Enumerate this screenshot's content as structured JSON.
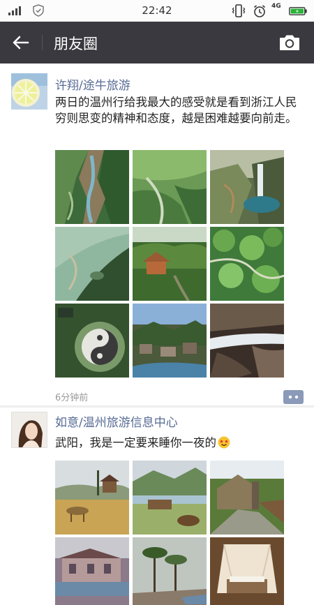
{
  "status_bar": {
    "time": "22:42",
    "network": "4G",
    "icons": [
      "signal-icon",
      "shield-icon",
      "vibrate-icon",
      "alarm-icon",
      "battery-icon"
    ],
    "battery_color": "#2ab43a"
  },
  "header": {
    "title": "朋友圈",
    "back_icon": "back-arrow-icon",
    "camera_icon": "camera-icon",
    "background_color": "#39393f"
  },
  "feed": {
    "link_color": "#576b95",
    "posts": [
      {
        "username": "许翔/途牛旅游",
        "text": "两日的温州行给我最大的感受就是看到浙江人民穷则思变的精神和态度，越是困难越要向前走。",
        "time": "6分钟前",
        "photos": [
          "aerial gorge with river",
          "green forested valley",
          "waterfall with pool",
          "aerial lake shore",
          "wooden pavilion in forest",
          "tree canopy from above",
          "taiji yin-yang plaza",
          "village in valley",
          "rocky stream cascade"
        ]
      },
      {
        "username": "如意/温州旅游信息中心",
        "text": "武阳，我是一定要来睡你一夜的",
        "emoji": "star-struck-emoji",
        "photos": [
          "golden meadow with pavilion",
          "mountain lake meadow",
          "stone village path",
          "villa with pool",
          "palm trees poolside",
          "canopy bed"
        ]
      }
    ]
  }
}
